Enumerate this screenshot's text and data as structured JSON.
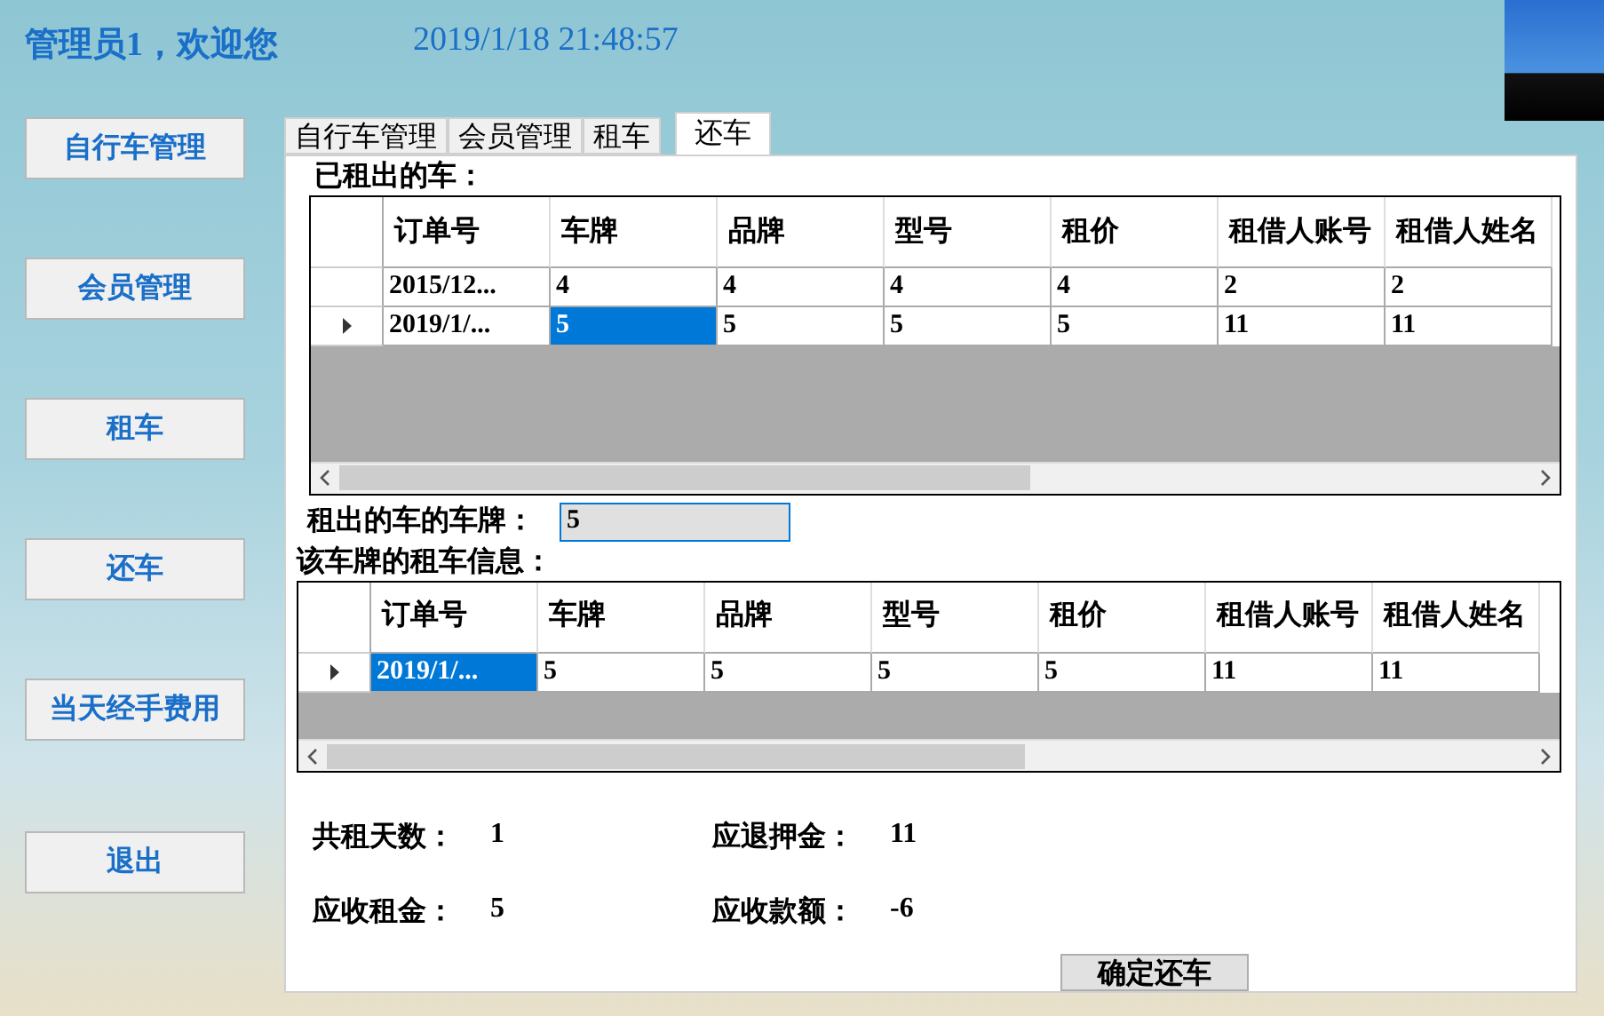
{
  "header": {
    "greeting": "管理员1，欢迎您",
    "datetime": "2019/1/18 21:48:57"
  },
  "sidebar": {
    "items": [
      {
        "label": "自行车管理"
      },
      {
        "label": "会员管理"
      },
      {
        "label": "租车"
      },
      {
        "label": "还车"
      },
      {
        "label": "当天经手费用"
      },
      {
        "label": "退出"
      }
    ]
  },
  "tabs": [
    {
      "label": "自行车管理",
      "selected": false
    },
    {
      "label": "会员管理",
      "selected": false
    },
    {
      "label": "租车",
      "selected": false
    },
    {
      "label": "还车",
      "selected": true
    }
  ],
  "rented_section": {
    "title": "已租出的车：",
    "table": {
      "columns": [
        "订单号",
        "车牌",
        "品牌",
        "型号",
        "租价",
        "租借人账号",
        "租借人姓名"
      ],
      "rows": [
        {
          "current": false,
          "cells": [
            {
              "text": "2015/12...",
              "selected": false
            },
            {
              "text": "4",
              "selected": false
            },
            {
              "text": "4",
              "selected": false
            },
            {
              "text": "4",
              "selected": false
            },
            {
              "text": "4",
              "selected": false
            },
            {
              "text": "2",
              "selected": false
            },
            {
              "text": "2",
              "selected": false
            }
          ]
        },
        {
          "current": true,
          "cells": [
            {
              "text": "2019/1/...",
              "selected": false
            },
            {
              "text": "5",
              "selected": true
            },
            {
              "text": "5",
              "selected": false
            },
            {
              "text": "5",
              "selected": false
            },
            {
              "text": "5",
              "selected": false
            },
            {
              "text": "11",
              "selected": false
            },
            {
              "text": "11",
              "selected": false
            }
          ]
        }
      ]
    }
  },
  "plate_field": {
    "label": "租出的车的车牌：",
    "value": "5"
  },
  "info_section": {
    "title": "该车牌的租车信息：",
    "table": {
      "columns": [
        "订单号",
        "车牌",
        "品牌",
        "型号",
        "租价",
        "租借人账号",
        "租借人姓名"
      ],
      "rows": [
        {
          "current": true,
          "cells": [
            {
              "text": "2019/1/...",
              "selected": true
            },
            {
              "text": "5",
              "selected": false
            },
            {
              "text": "5",
              "selected": false
            },
            {
              "text": "5",
              "selected": false
            },
            {
              "text": "5",
              "selected": false
            },
            {
              "text": "11",
              "selected": false
            },
            {
              "text": "11",
              "selected": false
            }
          ]
        }
      ]
    }
  },
  "summary": [
    {
      "label": "共租天数：",
      "value": "1"
    },
    {
      "label": "应退押金：",
      "value": "11"
    },
    {
      "label": "应收租金：",
      "value": "5"
    },
    {
      "label": "应收款额：",
      "value": "-6"
    }
  ],
  "confirm_button": "确定还车"
}
